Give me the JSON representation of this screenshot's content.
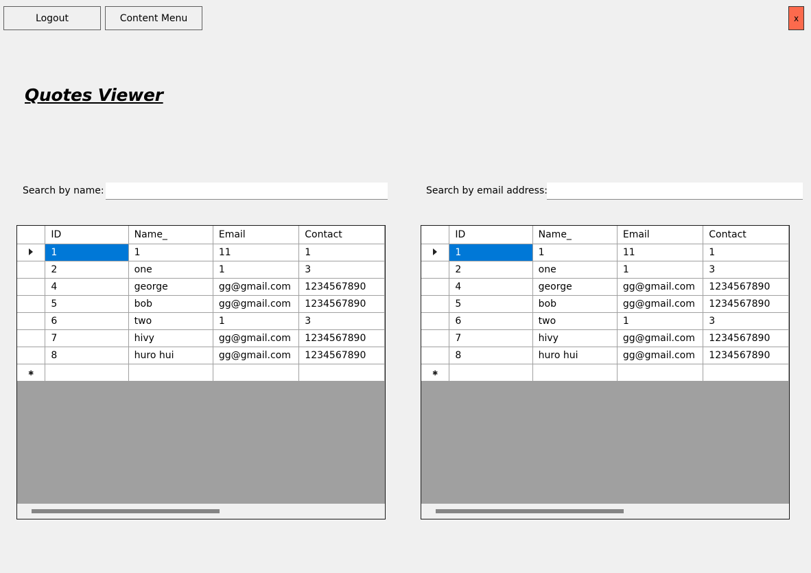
{
  "toolbar": {
    "logout_label": "Logout",
    "content_menu_label": "Content Menu",
    "close_label": "x"
  },
  "page_title": "Quotes Viewer",
  "search": {
    "name_label": "Search by name:",
    "name_value": "",
    "email_label": "Search by email address:",
    "email_value": ""
  },
  "colors": {
    "close_button": "#fc6a4d",
    "selection": "#0078d7",
    "grid_background": "#a0a0a0"
  },
  "grid_left": {
    "columns": [
      "ID",
      "Name_",
      "Email",
      "Contact"
    ],
    "rows": [
      [
        "1",
        "1",
        "11",
        "1"
      ],
      [
        "2",
        "one",
        "1",
        "3"
      ],
      [
        "4",
        "george",
        "gg@gmail.com",
        "1234567890"
      ],
      [
        "5",
        "bob",
        "gg@gmail.com",
        "1234567890"
      ],
      [
        "6",
        "two",
        "1",
        "3"
      ],
      [
        "7",
        "hivy",
        "gg@gmail.com",
        "1234567890"
      ],
      [
        "8",
        "huro hui",
        "gg@gmail.com",
        "1234567890"
      ]
    ]
  },
  "grid_right": {
    "columns": [
      "ID",
      "Name_",
      "Email",
      "Contact"
    ],
    "rows": [
      [
        "1",
        "1",
        "11",
        "1"
      ],
      [
        "2",
        "one",
        "1",
        "3"
      ],
      [
        "4",
        "george",
        "gg@gmail.com",
        "1234567890"
      ],
      [
        "5",
        "bob",
        "gg@gmail.com",
        "1234567890"
      ],
      [
        "6",
        "two",
        "1",
        "3"
      ],
      [
        "7",
        "hivy",
        "gg@gmail.com",
        "1234567890"
      ],
      [
        "8",
        "huro hui",
        "gg@gmail.com",
        "1234567890"
      ]
    ]
  }
}
